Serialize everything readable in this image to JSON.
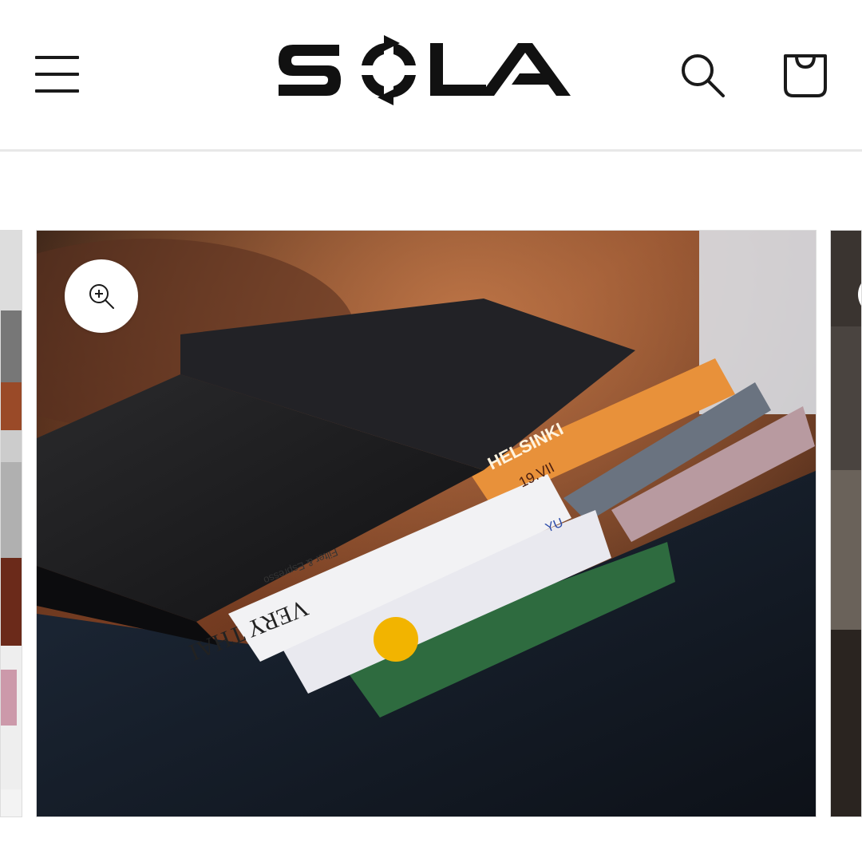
{
  "header": {
    "logo_text": "SOLA",
    "menu_icon": "hamburger-menu-icon",
    "search_icon": "search-icon",
    "cart_icon": "shopping-bag-icon"
  },
  "gallery": {
    "main_image": {
      "card_text_1": "VERY THAI",
      "card_text_2": "Filter & Espresso",
      "card_text_3": "HELSINKI",
      "card_text_4": "19.VII",
      "card_text_5": "YU"
    },
    "zoom_icon": "zoom-in-icon"
  },
  "colors": {
    "accent": "#1a1a1a",
    "divider": "#e8e8e8",
    "card_orange": "#e8913a",
    "card_green": "#2e6b3f"
  }
}
